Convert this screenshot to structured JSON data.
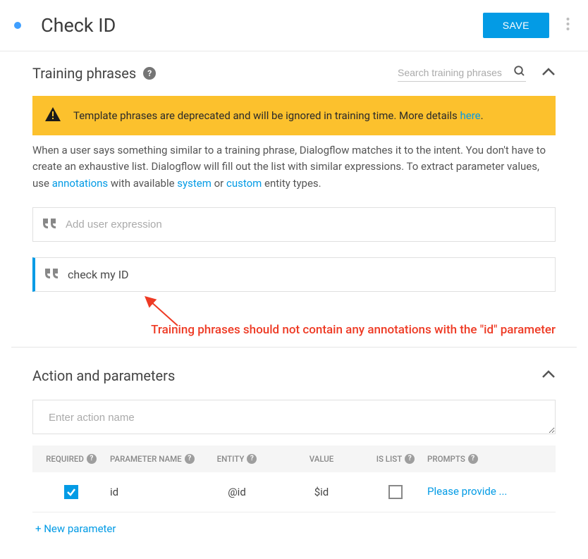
{
  "header": {
    "title": "Check ID",
    "save_label": "SAVE"
  },
  "training": {
    "section_title": "Training phrases",
    "search_placeholder": "Search training phrases",
    "warning_text": "Template phrases are deprecated and will be ignored in training time. More details ",
    "warning_link": "here",
    "description_pre": "When a user says something similar to a training phrase, Dialogflow matches it to the intent. You don't have to create an exhaustive list. Dialogflow will fill out the list with similar expressions. To extract parameter values, use ",
    "link_annotations": "annotations",
    "description_mid1": " with available ",
    "link_system": "system",
    "description_mid2": " or ",
    "link_custom": "custom",
    "description_post": " entity types.",
    "add_placeholder": "Add user expression",
    "phrase_1": "check my ID",
    "annotation": "Training phrases should not contain any annotations with the \"id\" parameter"
  },
  "action": {
    "section_title": "Action and parameters",
    "action_placeholder": "Enter action name",
    "headers": {
      "required": "REQUIRED",
      "param_name": "PARAMETER NAME",
      "entity": "ENTITY",
      "value": "VALUE",
      "is_list": "IS LIST",
      "prompts": "PROMPTS"
    },
    "row": {
      "name": "id",
      "entity": "@id",
      "value": "$id",
      "prompt": "Please provide ..."
    },
    "new_param": "+  New parameter"
  }
}
